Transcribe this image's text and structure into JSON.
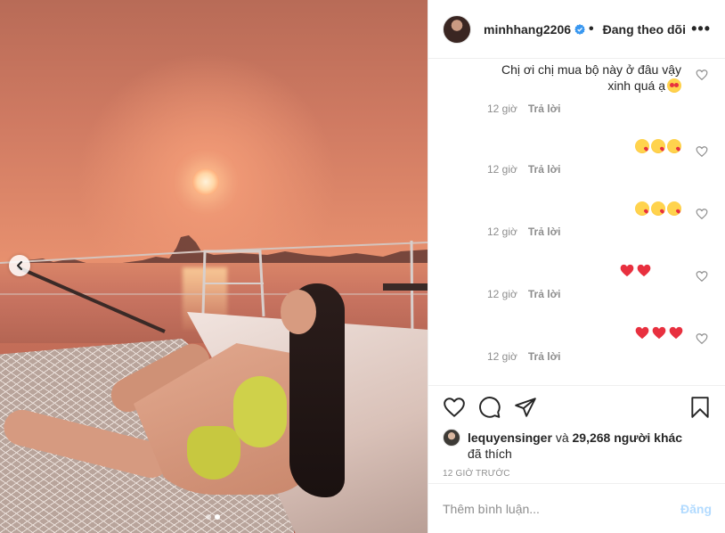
{
  "post": {
    "username": "minhhang2206",
    "follow_status": "Đang theo dõi",
    "more_label": "•••",
    "colors": {
      "verified": "#3897f0",
      "heart": "#ed4956",
      "post_disabled": "#b3dbff"
    }
  },
  "comments": [
    {
      "text": "Chị ơi chị mua bộ này ở đâu vậy xinh quá ạ",
      "emoji": [
        "smiling-face-with-hearts"
      ],
      "time": "12 giờ",
      "reply": "Trả lời"
    },
    {
      "text": "",
      "emoji": [
        "kissing-face",
        "kissing-face",
        "kissing-face"
      ],
      "time": "12 giờ",
      "reply": "Trả lời"
    },
    {
      "text": "",
      "emoji": [
        "kissing-face",
        "kissing-face",
        "kissing-face"
      ],
      "time": "12 giờ",
      "reply": "Trả lời"
    },
    {
      "text": "",
      "emoji": [
        "red-heart",
        "red-heart"
      ],
      "time": "12 giờ",
      "reply": "Trả lời"
    },
    {
      "text": "",
      "emoji": [
        "red-heart",
        "red-heart",
        "red-heart"
      ],
      "time": "12 giờ",
      "reply": "Trả lời"
    }
  ],
  "likes": {
    "liker": "lequyensinger",
    "connector": "và",
    "count": "29,268 người khác",
    "suffix": "đã thích"
  },
  "timestamp": "12 giờ trước",
  "add_comment": {
    "placeholder": "Thêm bình luận...",
    "post_label": "Đăng"
  },
  "carousel": {
    "dots": 2,
    "active": 1
  }
}
